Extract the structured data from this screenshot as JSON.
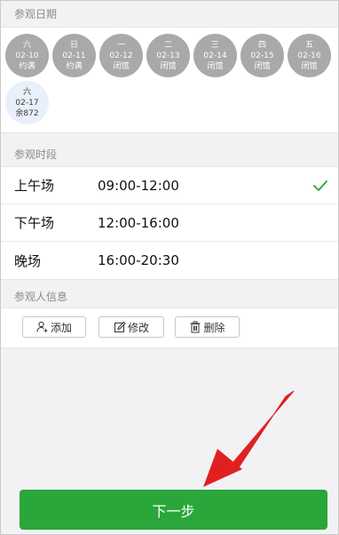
{
  "sections": {
    "date_title": "参观日期",
    "slot_title": "参观时段",
    "visitor_title": "参观人信息"
  },
  "dates": [
    {
      "weekday": "六",
      "date": "02-10",
      "status": "约满"
    },
    {
      "weekday": "日",
      "date": "02-11",
      "status": "约满"
    },
    {
      "weekday": "一",
      "date": "02-12",
      "status": "闭馆"
    },
    {
      "weekday": "二",
      "date": "02-13",
      "status": "闭馆"
    },
    {
      "weekday": "三",
      "date": "02-14",
      "status": "闭馆"
    },
    {
      "weekday": "四",
      "date": "02-15",
      "status": "闭馆"
    },
    {
      "weekday": "五",
      "date": "02-16",
      "status": "闭馆"
    },
    {
      "weekday": "六",
      "date": "02-17",
      "status": "余872"
    }
  ],
  "slots": [
    {
      "name": "上午场",
      "time": "09:00-12:00"
    },
    {
      "name": "下午场",
      "time": "12:00-16:00"
    },
    {
      "name": "晚场",
      "time": "16:00-20:30"
    }
  ],
  "visitor_buttons": {
    "add": "添加",
    "edit": "修改",
    "delete": "删除"
  },
  "next_button": "下一步",
  "colors": {
    "accent_green": "#2aa63a",
    "annotation_red": "#e02020",
    "unavailable_gray": "#a9a9a9"
  }
}
